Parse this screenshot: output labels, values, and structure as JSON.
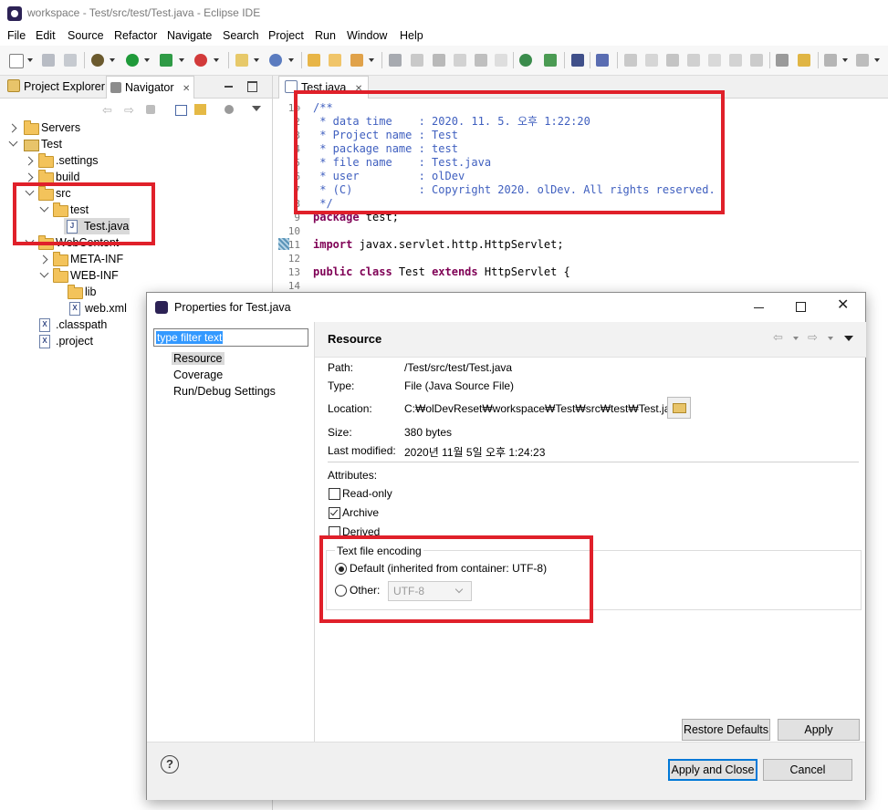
{
  "window": {
    "title": "workspace - Test/src/test/Test.java - Eclipse IDE"
  },
  "menu": [
    "File",
    "Edit",
    "Source",
    "Refactor",
    "Navigate",
    "Search",
    "Project",
    "Run",
    "Window",
    "Help"
  ],
  "left_view": {
    "tabs": [
      {
        "label": "Project Explorer"
      },
      {
        "label": "Navigator",
        "close": "✕"
      }
    ],
    "tree": [
      {
        "label": "Servers",
        "kind": "folder",
        "expanded": false
      },
      {
        "label": "Test",
        "kind": "project",
        "expanded": true
      },
      {
        "label": ".settings",
        "kind": "folder",
        "expanded": false
      },
      {
        "label": "build",
        "kind": "folder",
        "expanded": false
      },
      {
        "label": "src",
        "kind": "folder",
        "expanded": true
      },
      {
        "label": "test",
        "kind": "folder",
        "expanded": true
      },
      {
        "label": "Test.java",
        "kind": "java",
        "selected": true
      },
      {
        "label": "WebContent",
        "kind": "folder",
        "expanded": true
      },
      {
        "label": "META-INF",
        "kind": "folder",
        "expanded": false
      },
      {
        "label": "WEB-INF",
        "kind": "folder",
        "expanded": true
      },
      {
        "label": "lib",
        "kind": "folder"
      },
      {
        "label": "web.xml",
        "kind": "xml"
      },
      {
        "label": ".classpath",
        "kind": "xml"
      },
      {
        "label": ".project",
        "kind": "xml"
      }
    ]
  },
  "editor": {
    "tab": {
      "label": "Test.java",
      "close": "✕"
    },
    "lines": [
      {
        "n": "1⊖",
        "text": "/**"
      },
      {
        "n": "2",
        "text": " * data time    : 2020. 11. 5. 오후 1:22:20"
      },
      {
        "n": "3",
        "text": " * Project name : Test"
      },
      {
        "n": "4",
        "text": " * package name : test"
      },
      {
        "n": "5",
        "text": " * file name    : Test.java"
      },
      {
        "n": "6",
        "text": " * user         : olDev"
      },
      {
        "n": "7",
        "text": " * (C)          : Copyright 2020. olDev. All rights reserved."
      },
      {
        "n": "8",
        "text": " */"
      },
      {
        "n": "9",
        "kw": "package",
        "text": " test;"
      },
      {
        "n": "10",
        "text": ""
      },
      {
        "n": "11",
        "kw": "import",
        "text": " javax.servlet.http.HttpServlet;"
      },
      {
        "n": "12",
        "text": ""
      },
      {
        "n": "13",
        "kw": "public class",
        "text": " Test ",
        "kw2": "extends",
        "text2": " HttpServlet {"
      },
      {
        "n": "14",
        "text": ""
      }
    ]
  },
  "dialog": {
    "title": "Properties for Test.java",
    "filter_placeholder": "type filter text",
    "nav": [
      "Resource",
      "Coverage",
      "Run/Debug Settings"
    ],
    "section_title": "Resource",
    "props": [
      {
        "label": "Path:",
        "value": "/Test/src/test/Test.java"
      },
      {
        "label": "Type:",
        "value": "File  (Java Source File)"
      },
      {
        "label": "Location:",
        "value": "C:₩olDevReset₩workspace₩Test₩src₩test₩Test.java"
      },
      {
        "label": "Size:",
        "value": "380  bytes"
      },
      {
        "label": "Last modified:",
        "value": "2020년 11월 5일 오후 1:24:23"
      }
    ],
    "attributes_label": "Attributes:",
    "attributes": [
      {
        "label": "Read-only",
        "checked": false
      },
      {
        "label": "Archive",
        "checked": true
      },
      {
        "label": "Derived",
        "checked": false
      }
    ],
    "encoding": {
      "group_label": "Text file encoding",
      "default_label": "Default (inherited from container: UTF-8)",
      "other_label": "Other:",
      "other_value": "UTF-8"
    },
    "buttons": {
      "restore_defaults": "Restore Defaults",
      "apply": "Apply",
      "apply_and_close": "Apply and Close",
      "cancel": "Cancel",
      "help": "?"
    }
  },
  "colors": {
    "highlight": "#e0202a",
    "java_comment": "#3f5fbf",
    "keyword": "#7f0055",
    "selection": "#3399ff"
  }
}
